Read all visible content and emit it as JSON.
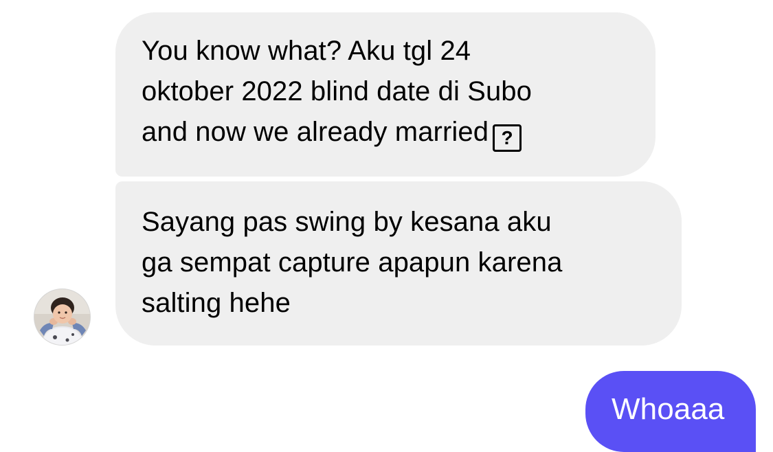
{
  "thread": {
    "incoming": [
      {
        "lines": [
          "You know what? Aku tgl 24",
          "oktober 2022 blind date di Subo",
          "and now we already married"
        ],
        "trailing_glyph": "?"
      },
      {
        "lines": [
          "Sayang pas swing by kesana aku",
          "ga sempat capture apapun karena",
          "salting hehe"
        ]
      }
    ],
    "outgoing": [
      {
        "text": "Whoaaa"
      }
    ],
    "avatar": {
      "icon": "child-photo-avatar"
    }
  },
  "colors": {
    "incoming_bubble": "#efefef",
    "outgoing_bubble": "#5a50f5",
    "outgoing_text": "#ffffff"
  }
}
